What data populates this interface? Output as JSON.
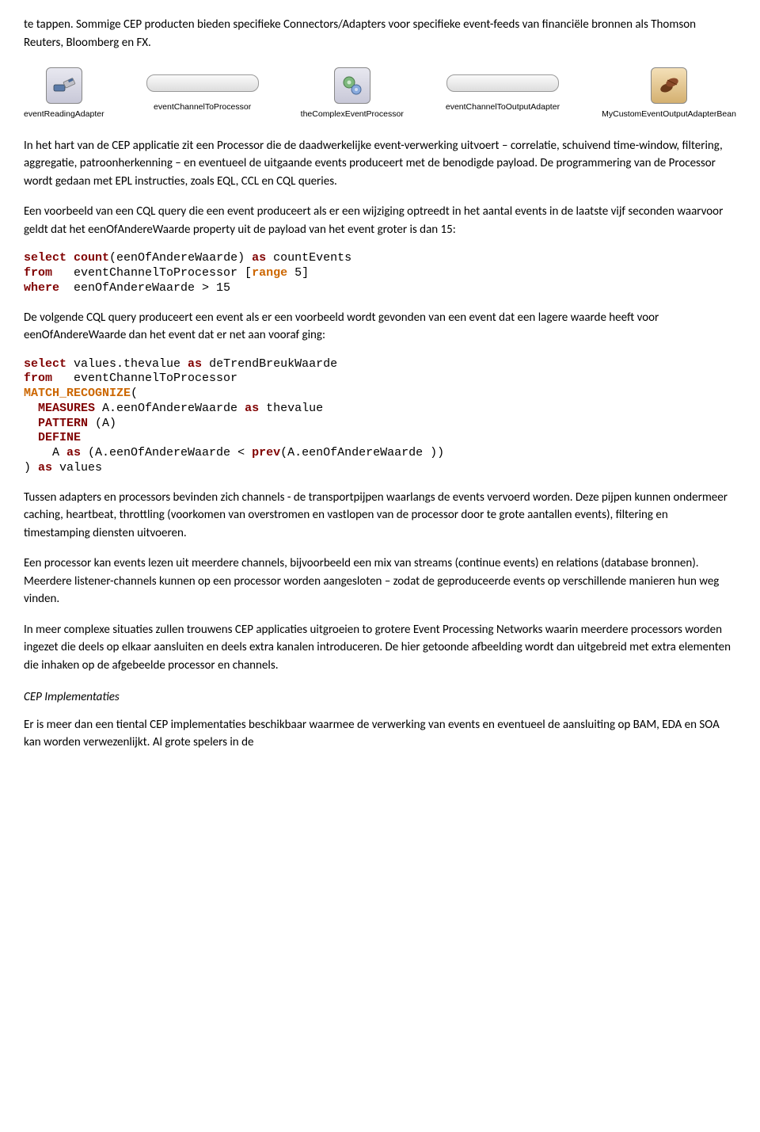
{
  "paragraphs": {
    "p1": "te tappen. Sommige CEP producten bieden specifieke Connectors/Adapters voor specifieke event-feeds van financiële bronnen als Thomson Reuters, Bloomberg en FX.",
    "p2": "In het hart van de CEP applicatie zit een Processor die de daadwerkelijke event-verwerking uitvoert – correlatie, schuivend time-window, filtering, aggregatie, patroonherkenning – en eventueel de uitgaande events produceert met de benodigde payload. De programmering van de Processor wordt gedaan met EPL instructies, zoals EQL, CCL en CQL queries.",
    "p3": "Een voorbeeld van een CQL query die een event produceert als er een wijziging optreedt in het aantal events in de laatste vijf seconden waarvoor geldt dat het eenOfAndereWaarde property uit de payload van het event groter is dan 15:",
    "p4": "De volgende CQL query produceert een event als er een voorbeeld wordt gevonden van een event dat een lagere waarde heeft voor eenOfAndereWaarde dan het event dat er net aan vooraf ging:",
    "p5": "Tussen adapters en processors bevinden zich channels -  de transportpijpen waarlangs de events vervoerd worden. Deze pijpen kunnen ondermeer caching, heartbeat, throttling (voorkomen van overstromen en vastlopen van de processor door te grote aantallen events), filtering en timestamping diensten uitvoeren.",
    "p6": "Een processor kan events lezen uit meerdere channels, bijvoorbeeld een mix van streams (continue events) en relations (database bronnen). Meerdere listener-channels kunnen op een processor worden aangesloten – zodat de geproduceerde events op verschillende manieren hun weg vinden.",
    "p7": "In meer complexe situaties zullen trouwens CEP applicaties uitgroeien to grotere Event Processing Networks waarin meerdere processors worden ingezet die deels op elkaar aansluiten en deels extra kanalen introduceren. De hier getoonde afbeelding wordt dan uitgebreid met extra elementen die inhaken op de afgebeelde processor en channels.",
    "heading1": "CEP Implementaties",
    "p8": "Er is meer dan een tiental CEP implementaties beschikbaar waarmee de verwerking van events en eventueel de aansluiting op BAM, EDA en SOA kan worden verwezenlijkt. Al grote spelers in de"
  },
  "diagram": {
    "node1": "eventReadingAdapter",
    "channel1": "eventChannelToProcessor",
    "node2": "theComplexEventProcessor",
    "channel2": "eventChannelToOutputAdapter",
    "node3": "MyCustomEventOutputAdapterBean"
  },
  "code1": {
    "select": "select",
    "count": "count",
    "countArg": "(eenOfAndereWaarde)",
    "as1": "as",
    "countEvents": " countEvents",
    "from": "from",
    "fromSrc": "   eventChannelToProcessor [",
    "range": "range",
    "rangeEnd": " 5]",
    "where": "where",
    "whereCond": "  eenOfAndereWaarde > 15"
  },
  "code2": {
    "select": "select",
    "selectExpr": " values.thevalue ",
    "as1": "as",
    "alias1": " deTrendBreukWaarde",
    "from": "from",
    "fromSrc": "   eventChannelToProcessor",
    "match": "MATCH_RECOGNIZE",
    "openParen": "(",
    "measures": "MEASURES",
    "measuresExpr": " A.eenOfAndereWaarde ",
    "as2": "as",
    "thevalue": " thevalue",
    "pattern": "PATTERN",
    "patternExpr": " (A)",
    "define": "DEFINE",
    "defineA": "    A ",
    "as3": "as",
    "defineOpen": " (A.eenOfAndereWaarde < ",
    "prev": "prev",
    "prevArg": "(A.eenOfAndereWaarde ))",
    "close": ") ",
    "as4": "as",
    "values": " values"
  }
}
